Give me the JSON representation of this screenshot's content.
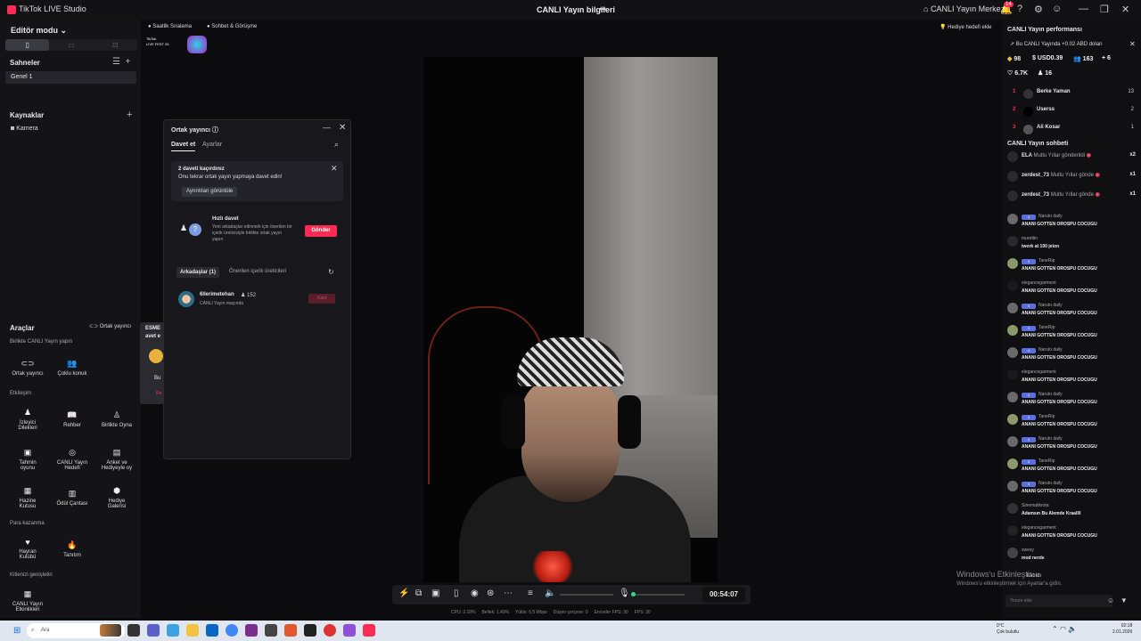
{
  "window": {
    "app_title": "TikTok LIVE Studio",
    "center_title": "CANLI Yayın bilgileri",
    "live_center": "CANLI Yayın Merkezi",
    "notification_count": "14"
  },
  "left_panel": {
    "editor_mode": "Editör modu",
    "scenes_title": "Sahneler",
    "scene_item": "Genel 1",
    "sources_title": "Kaynaklar",
    "source_camera": "Kamera"
  },
  "top_chips": {
    "hourly_ranking": "Saatlik Sıralama",
    "chat_meeting": "Sohbet & Görüşme",
    "fest_logo_line1": "TikTok",
    "fest_logo_line2": "LIVE FEST 25",
    "gift_goal": "Hediye hedefi ekle"
  },
  "tools": {
    "title": "Araçlar",
    "cohost_button": "Ortak yayıncı",
    "section_live_together": "Birlikte CANLI Yayın yapın",
    "section_interaction": "Etkileşim",
    "section_earn": "Para kazanma",
    "section_grow": "Kitlenizi genişletin",
    "items": {
      "cohost": "Ortak yayıncı",
      "multi_guest": "Çoklu konuk",
      "viewer_wishes_1": "İzleyici",
      "viewer_wishes_2": "Dilekleri",
      "guide": "Rehber",
      "play_together": "Birlikte Oyna",
      "guess_game_1": "Tahmin",
      "guess_game_2": "oyunu",
      "live_goal_1": "CANLI Yayın",
      "live_goal_2": "Hedefi",
      "poll_1": "Anket ve",
      "poll_2": "Hediyeyle oy",
      "treasure_1": "Hazine",
      "treasure_2": "Kutusu",
      "reward_bag": "Ödül Çantası",
      "gift_gallery_1": "Hediye",
      "gift_gallery_2": "Galerisi",
      "fan_club_1": "Hayran",
      "fan_club_2": "Kulübü",
      "promotion": "Tanıtım",
      "live_events_1": "CANLI Yayın",
      "live_events_2": "Etkinlikleri"
    }
  },
  "behind_popup": {
    "line1": "ESME",
    "line2": "avet e",
    "line3": "Bu",
    "line4": "Re"
  },
  "cohost_dialog": {
    "title": "Ortak yayıncı",
    "tab_invite": "Davet et",
    "tab_settings": "Ayarlar",
    "missed_title": "2 daveti kaçırdınız",
    "missed_body": "Onu tekrar ortak yayın yapmaya davet edin!",
    "missed_details": "Ayrıntıları görüntüle",
    "quick_title": "Hızlı davet",
    "quick_desc": "Yeni arkadaşlar edinmek için önerilen bir içerik üreticisiyle birlikte ortak yayın yapın",
    "send_button": "Gönder",
    "friends_tab": "Arkadaşlar (1)",
    "suggested_tab": "Önerilen içerik üreticileri",
    "friend_name": "6llerimetehan",
    "friend_count": "152",
    "friend_status": "CANLI Yayın maçında",
    "join_button": "Katıl"
  },
  "right_panel": {
    "perf_title": "CANLI Yayın performansı",
    "earn_banner": "Bu CANLI Yayında +0.02 ABD doları",
    "stats": {
      "diamonds": "98",
      "usd": "USD0.39",
      "viewers": "163",
      "new_followers": "6",
      "likes": "6.7K",
      "gifters": "16"
    },
    "ranking": [
      {
        "rank": "1",
        "name": "Berke Yaman",
        "value": "13"
      },
      {
        "rank": "2",
        "name": "Userss",
        "value": "2"
      },
      {
        "rank": "3",
        "name": "Ali Kosar",
        "value": "1"
      }
    ],
    "chat_title": "CANLI Yayın sohbeti",
    "gifts": [
      {
        "name": "ELA",
        "text": "Mutlu Yıllar gönderildi",
        "mult": "x2"
      },
      {
        "name": "zerdest_73",
        "text": "Mutlu Yıllar gönde",
        "mult": "x1"
      },
      {
        "name": "zerdest_73",
        "text": "Mutlu Yıllar gönde",
        "mult": "x1"
      }
    ],
    "chat": [
      {
        "badge": "4",
        "name": "Naruto daily",
        "msg": "ANANI GOTTEN OROSPU COCUGU"
      },
      {
        "badge": "",
        "name": "murettin",
        "msg": "twork at 100 jeton"
      },
      {
        "badge": "3",
        "name": "TaneRip",
        "msg": "ANANI GOTTEN OROSPU COCUGU"
      },
      {
        "badge": "",
        "name": "elegancegarment",
        "msg": "ANANI GOTTEN OROSPU COCUGU"
      },
      {
        "badge": "4",
        "name": "Naruto daily",
        "msg": "ANANI GOTTEN OROSPU COCUGU"
      },
      {
        "badge": "3",
        "name": "TaneRip",
        "msg": "ANANI GOTTEN OROSPU COCUGU"
      },
      {
        "badge": "4",
        "name": "Naruto daily",
        "msg": "ANANI GOTTEN OROSPU COCUGU"
      },
      {
        "badge": "",
        "name": "elegancegarment",
        "msg": "ANANI GOTTEN OROSPU COCUGU"
      },
      {
        "badge": "4",
        "name": "Naruto daily",
        "msg": "ANANI GOTTEN OROSPU COCUGU"
      },
      {
        "badge": "3",
        "name": "TaneRip",
        "msg": "ANANI GOTTEN OROSPU COCUGU"
      },
      {
        "badge": "4",
        "name": "Naruto daily",
        "msg": "ANANI GOTTEN OROSPU COCUGU"
      },
      {
        "badge": "3",
        "name": "TaneRip",
        "msg": "ANANI GOTTEN OROSPU COCUGU"
      },
      {
        "badge": "4",
        "name": "Naruto daily",
        "msg": "ANANI GOTTEN OROSPU COCUGU"
      },
      {
        "badge": "",
        "name": "Sinematikrota",
        "msg": "Adamsın Bu Alemde Kraallll"
      },
      {
        "badge": "",
        "name": "elegancegarment",
        "msg": "ANANI GOTTEN OROSPU COCUGU"
      },
      {
        "badge": "",
        "name": "swesy",
        "msg": "mod nerde"
      }
    ],
    "joined_text": "katıldı",
    "comment_placeholder": "Yorum ekle"
  },
  "watermark": {
    "line1": "Windows'u Etkinleştir",
    "line2": "Windows'u etkinleştirmek için Ayarlar'a gidin."
  },
  "toolbar": {
    "timer": "00:54:07"
  },
  "stats_bar": {
    "cpu": "CPU: 2.18%",
    "memory": "Bellek: 1.49%",
    "upload": "Yükle: 6.5 Mbps",
    "dropped": "Düşen çerçeve: 0",
    "encoder_fps": "Encoder FPS: 30",
    "fps": "FPS: 30"
  },
  "taskbar": {
    "search_placeholder": "Ara",
    "weather_temp": "0°C",
    "weather_desc": "Çok bulutlu",
    "time": "02:18",
    "date": "2.01.2026"
  },
  "colors": {
    "accent": "#fe2c55",
    "panel_bg": "#141418",
    "background": "#0c0c0f"
  }
}
